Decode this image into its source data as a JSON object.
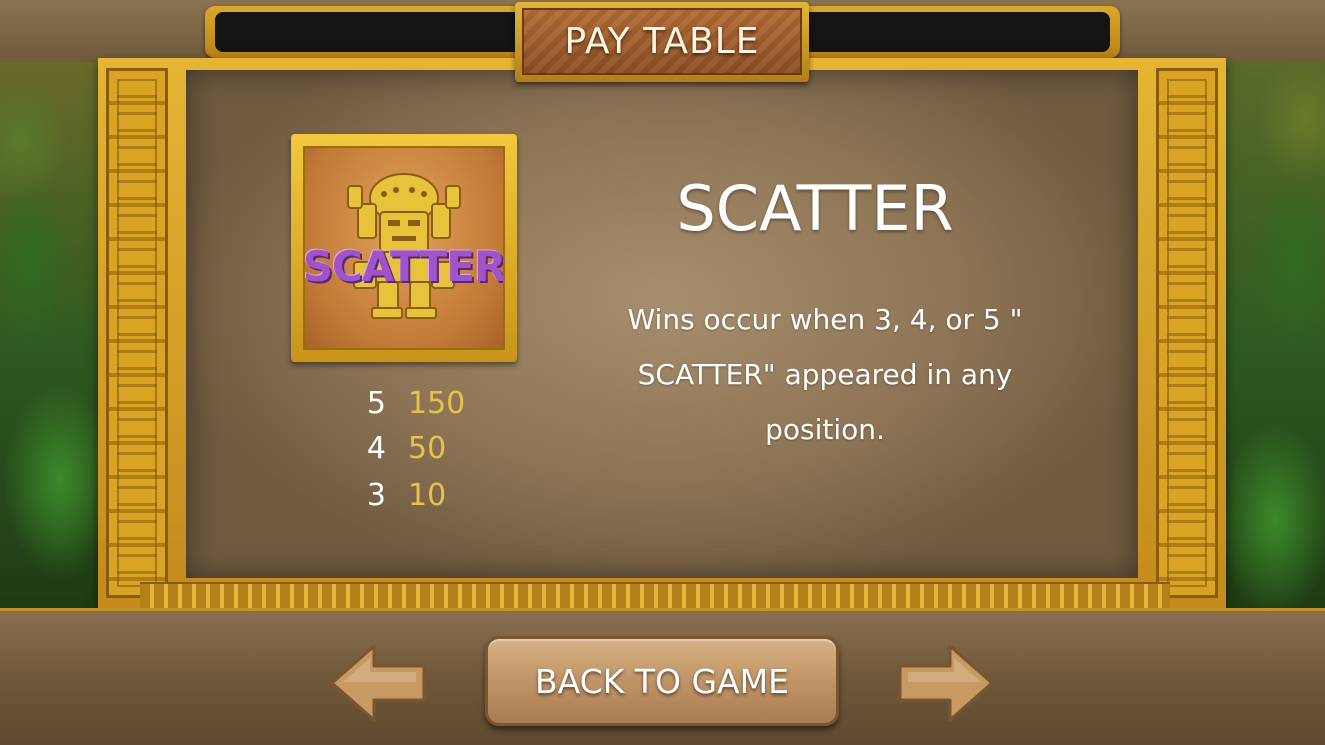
{
  "header": {
    "title": "PAY TABLE"
  },
  "symbol": {
    "label": "SCATTER",
    "icon": "scatter-idol-icon"
  },
  "payouts": [
    {
      "count": "5",
      "amount": "150"
    },
    {
      "count": "4",
      "amount": "50"
    },
    {
      "count": "3",
      "amount": "10"
    }
  ],
  "info": {
    "title": "SCATTER",
    "description_lines": [
      "Wins occur when 3, 4, or 5 \"",
      "SCATTER\" appeared in any",
      "position."
    ]
  },
  "footer": {
    "back_label": "BACK TO GAME",
    "prev_icon": "arrow-left-icon",
    "next_icon": "arrow-right-icon"
  },
  "colors": {
    "gold": "#e2b43a",
    "payout_amount": "#e7c14a",
    "scatter_purple": "#a054c8",
    "text": "#ffffff"
  }
}
